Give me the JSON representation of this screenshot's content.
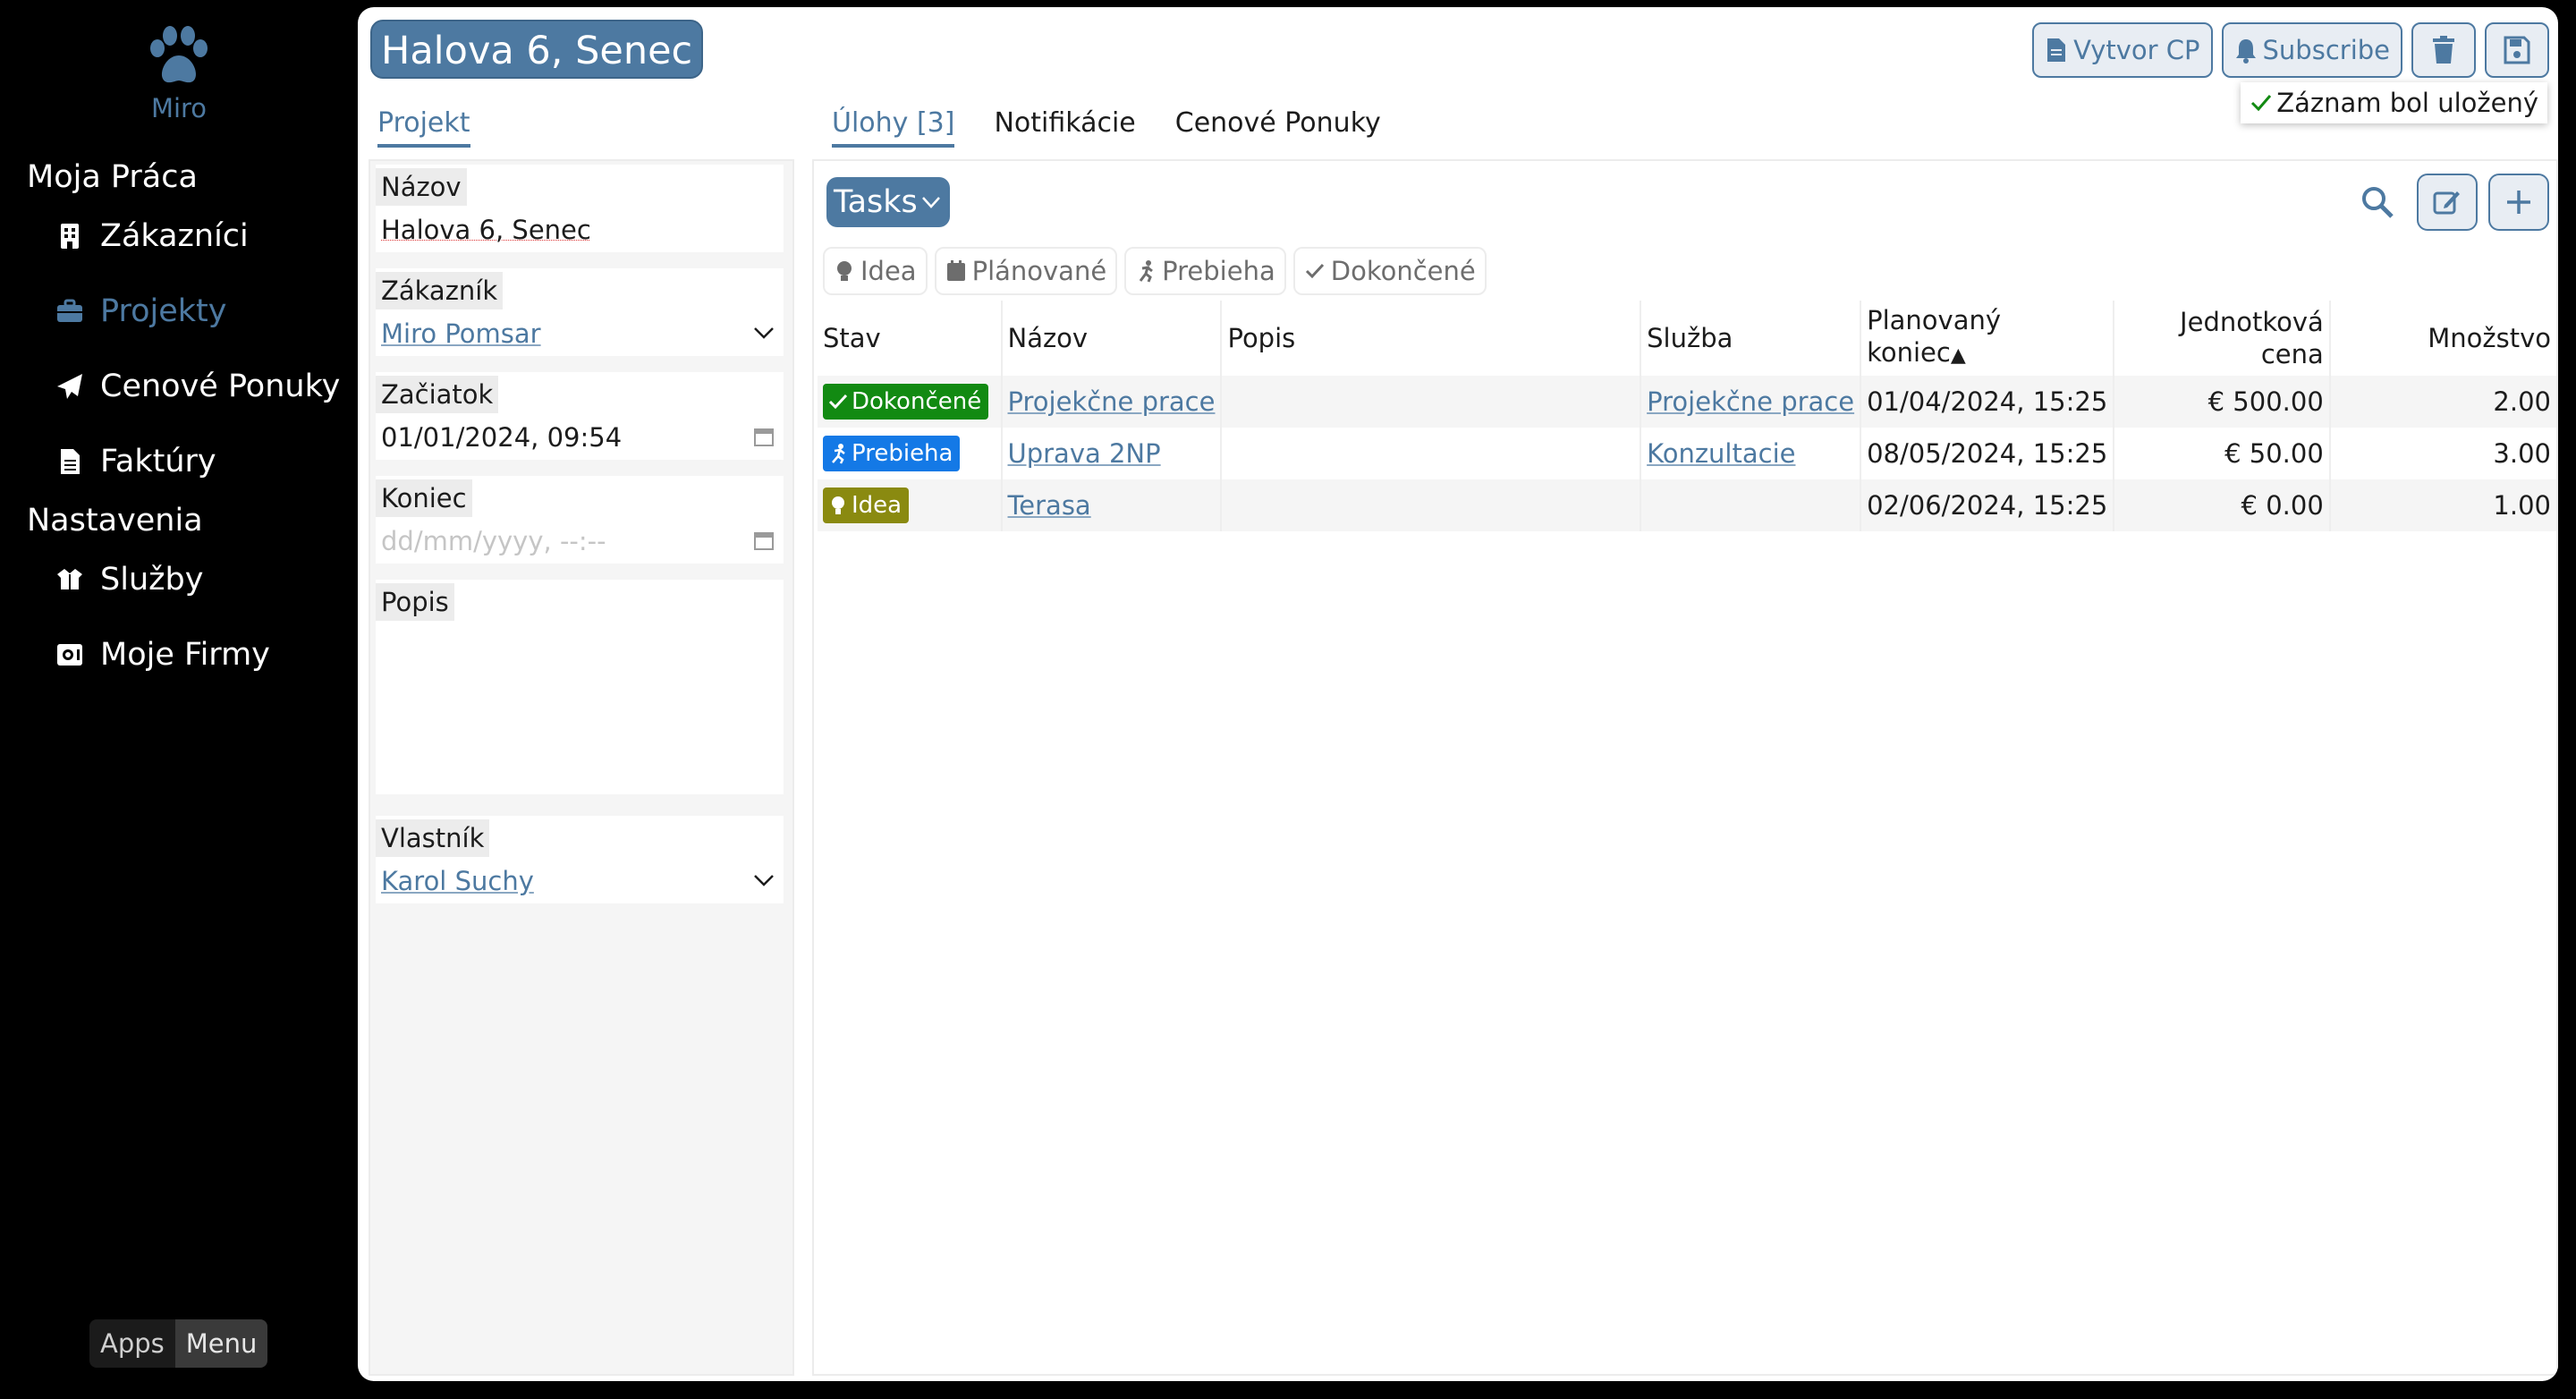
{
  "sidebar": {
    "brand": "Miro",
    "section_work": "Moja Práca",
    "items_work": [
      {
        "label": "Zákazníci",
        "icon": "building-icon"
      },
      {
        "label": "Projekty",
        "icon": "briefcase-icon",
        "active": true
      },
      {
        "label": "Cenové Ponuky",
        "icon": "paper-plane-icon"
      },
      {
        "label": "Faktúry",
        "icon": "document-icon"
      }
    ],
    "section_settings": "Nastavenia",
    "items_settings": [
      {
        "label": "Služby",
        "icon": "box-open-icon"
      },
      {
        "label": "Moje Firmy",
        "icon": "vault-icon"
      }
    ],
    "apps_label": "Apps",
    "menu_label": "Menu"
  },
  "header": {
    "title": "Halova 6, Senec",
    "create_offer_label": "Vytvor CP",
    "subscribe_label": "Subscribe",
    "toast": "Záznam bol uložený"
  },
  "form": {
    "tab": "Projekt",
    "fields": {
      "nazov_label": "Názov",
      "nazov_value": "Halova 6, Senec",
      "zakaznik_label": "Zákazník",
      "zakaznik_value": "Miro Pomsar",
      "zaciatok_label": "Začiatok",
      "zaciatok_value": "01/01/2024, 09:54",
      "koniec_label": "Koniec",
      "koniec_placeholder": "dd/mm/yyyy, --:--",
      "popis_label": "Popis",
      "popis_value": "",
      "vlastnik_label": "Vlastník",
      "vlastnik_value": "Karol Suchy"
    }
  },
  "tabs": {
    "tasks": "Úlohy [3]",
    "notifications": "Notifikácie",
    "offers": "Cenové Ponuky"
  },
  "tasks": {
    "view_label": "Tasks",
    "filters": [
      "Idea",
      "Plánované",
      "Prebieha",
      "Dokončené"
    ],
    "columns": {
      "stav": "Stav",
      "nazov": "Názov",
      "popis": "Popis",
      "sluzba": "Služba",
      "koniec_line1": "Planovaný",
      "koniec_line2": "koniec",
      "cena_line1": "Jednotková",
      "cena_line2": "cena",
      "mnozstvo": "Množstvo"
    },
    "rows": [
      {
        "status": "Dokončené",
        "status_color": "#128a12",
        "name": "Projekčne prace",
        "desc": "",
        "service": "Projekčne prace",
        "end": "01/04/2024, 15:25",
        "price": "€ 500.00",
        "qty": "2.00"
      },
      {
        "status": "Prebieha",
        "status_color": "#1479e6",
        "name": "Uprava 2NP",
        "desc": "",
        "service": "Konzultacie",
        "end": "08/05/2024, 15:25",
        "price": "€ 50.00",
        "qty": "3.00"
      },
      {
        "status": "Idea",
        "status_color": "#8a8a10",
        "name": "Terasa",
        "desc": "",
        "service": "",
        "end": "02/06/2024, 15:25",
        "price": "€ 0.00",
        "qty": "1.00"
      }
    ]
  },
  "colors": {
    "accent": "#4d79a1",
    "done": "#128a12",
    "in_progress": "#1479e6",
    "idea": "#8a8a10"
  }
}
